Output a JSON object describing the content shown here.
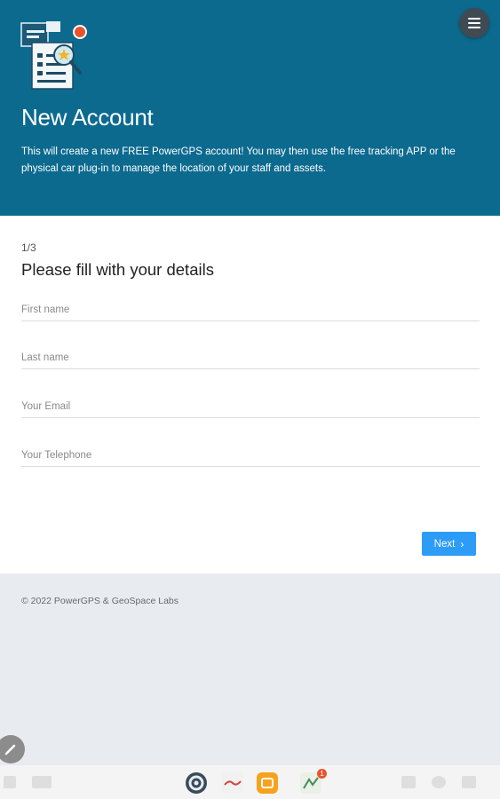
{
  "header": {
    "title": "New Account",
    "description": "This will create a new FREE PowerGPS account! You may then use the free tracking APP or the physical car plug-in to manage the location of your staff and assets.",
    "menu_icon": "hamburger-menu-icon",
    "logo_icon": "document-search-illustration",
    "background_color": "#0c6a8f"
  },
  "form": {
    "step": "1/3",
    "heading": "Please fill with your details",
    "fields": {
      "first_name": {
        "placeholder": "First name",
        "value": ""
      },
      "last_name": {
        "placeholder": "Last name",
        "value": ""
      },
      "email": {
        "placeholder": "Your Email",
        "value": ""
      },
      "telephone": {
        "placeholder": "Your Telephone",
        "value": ""
      }
    },
    "next_label": "Next",
    "next_icon": "chevron-right-icon",
    "accent_color": "#2d9cf6"
  },
  "footer": {
    "copyright": "© 2022 PowerGPS & GeoSpace Labs"
  },
  "taskbar": {
    "apps": [
      "settings-app-icon",
      "gallery-app-icon",
      "files-app-icon",
      "maps-app-icon"
    ],
    "notification_count": "1"
  }
}
